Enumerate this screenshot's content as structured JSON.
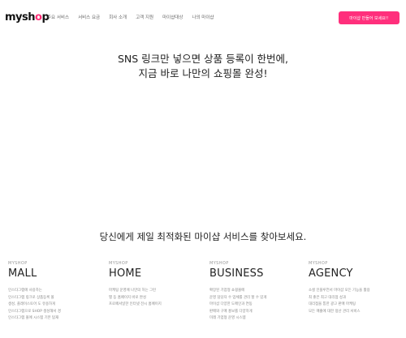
{
  "header": {
    "logo_text": "mysh",
    "logo_accent": "o",
    "logo_end": "p",
    "nav": [
      "주요 서비스",
      "서비스 요금",
      "회사 소개",
      "고객 지원",
      "마이샵대상",
      "나의 마이샵"
    ],
    "cta_label": "마이샵 만들어 보세요!!"
  },
  "hero": {
    "line1": "SNS 링크만 넣으면 상품 등록이 한번에,",
    "line2": "지금 바로 나만의 쇼핑몰 완성!"
  },
  "subhead": "당신에게 제일 최적화된 마이샵 서비스를 찾아보세요.",
  "services": [
    {
      "label": "MYSHOP",
      "title": "MALL",
      "desc": [
        "인스타그램에 사용하는",
        "인스타그램 링크로 상품등록 몰",
        "생성, 플레이스토어 도 유용하게",
        "인스타그램으로 SHOP 생성해서 경",
        "인스타그램 몰에 시스템 기본 탑재"
      ]
    },
    {
      "label": "MYSHOP",
      "title": "HOME",
      "desc": [
        "마케팅 운영에 나만의 하는 그런",
        "별 등 홈페이지 바로 완성",
        "프로페셔널한 인터넷 전시 홈페이지"
      ]
    },
    {
      "label": "MYSHOP",
      "title": "BUSINESS",
      "desc": [
        "확장된 기업형 쇼핑몰에",
        "운영 담당자 수 업체를 관리 할 수 있게",
        "마이샵 다양한 도메인과 연동",
        "판매와 구매 홍보를 다양하게",
        "미래 기업형 운영 시스템"
      ]
    },
    {
      "label": "MYSHOP",
      "title": "AGENCY",
      "desc": [
        "소셜 인플루언서 마이샵 모든 기능을 활용",
        "최 좋은 최고 대리점 성과",
        "대리점을 통한 광고 판매 마케팅",
        "모든 매출에 대한 정산 관리 서비스"
      ]
    }
  ]
}
